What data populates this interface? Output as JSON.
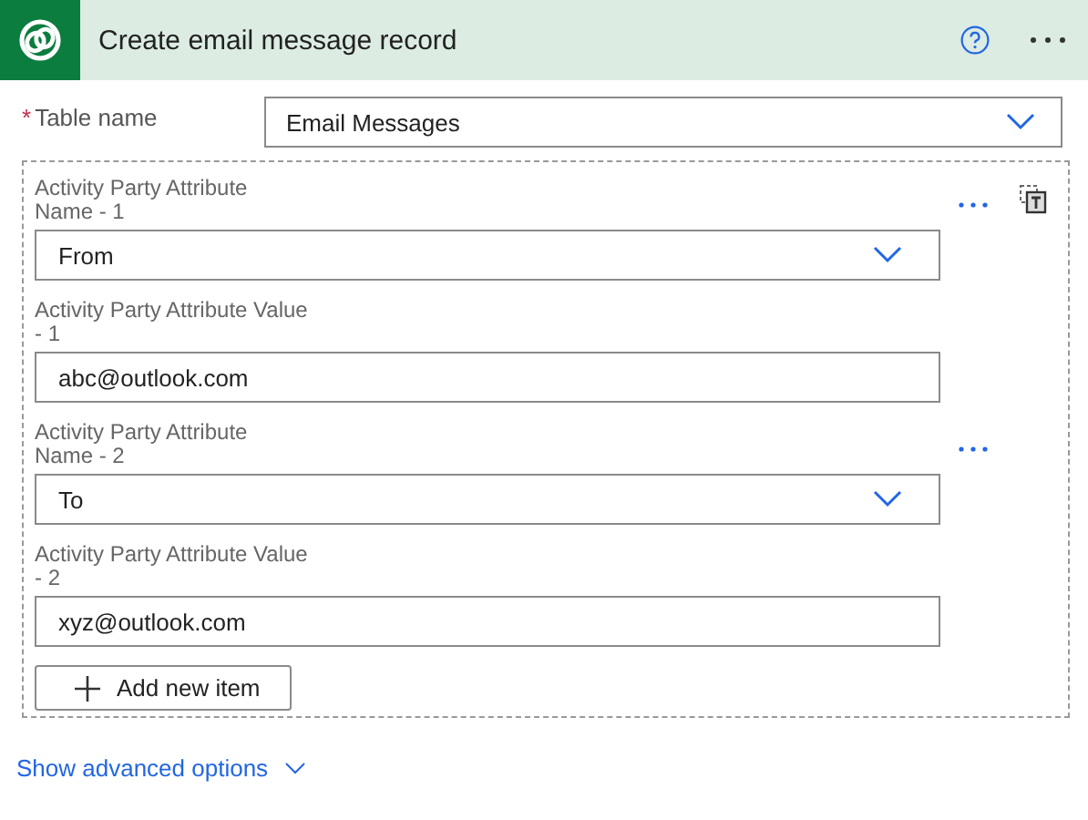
{
  "header": {
    "title": "Create email message record"
  },
  "table_name": {
    "required_mark": "*",
    "label": "Table name",
    "value": "Email Messages"
  },
  "fields": [
    {
      "kind": "dropdown",
      "label": "Activity Party Attribute Name - 1",
      "value": "From"
    },
    {
      "kind": "text",
      "label": "Activity Party Attribute Value - 1",
      "value": "abc@outlook.com"
    },
    {
      "kind": "dropdown",
      "label": "Activity Party Attribute Name - 2",
      "value": "To"
    },
    {
      "kind": "text",
      "label": "Activity Party Attribute Value - 2",
      "value": "xyz@outlook.com"
    }
  ],
  "add_button": {
    "label": "Add new item"
  },
  "advanced_link": {
    "label": "Show advanced options"
  }
}
